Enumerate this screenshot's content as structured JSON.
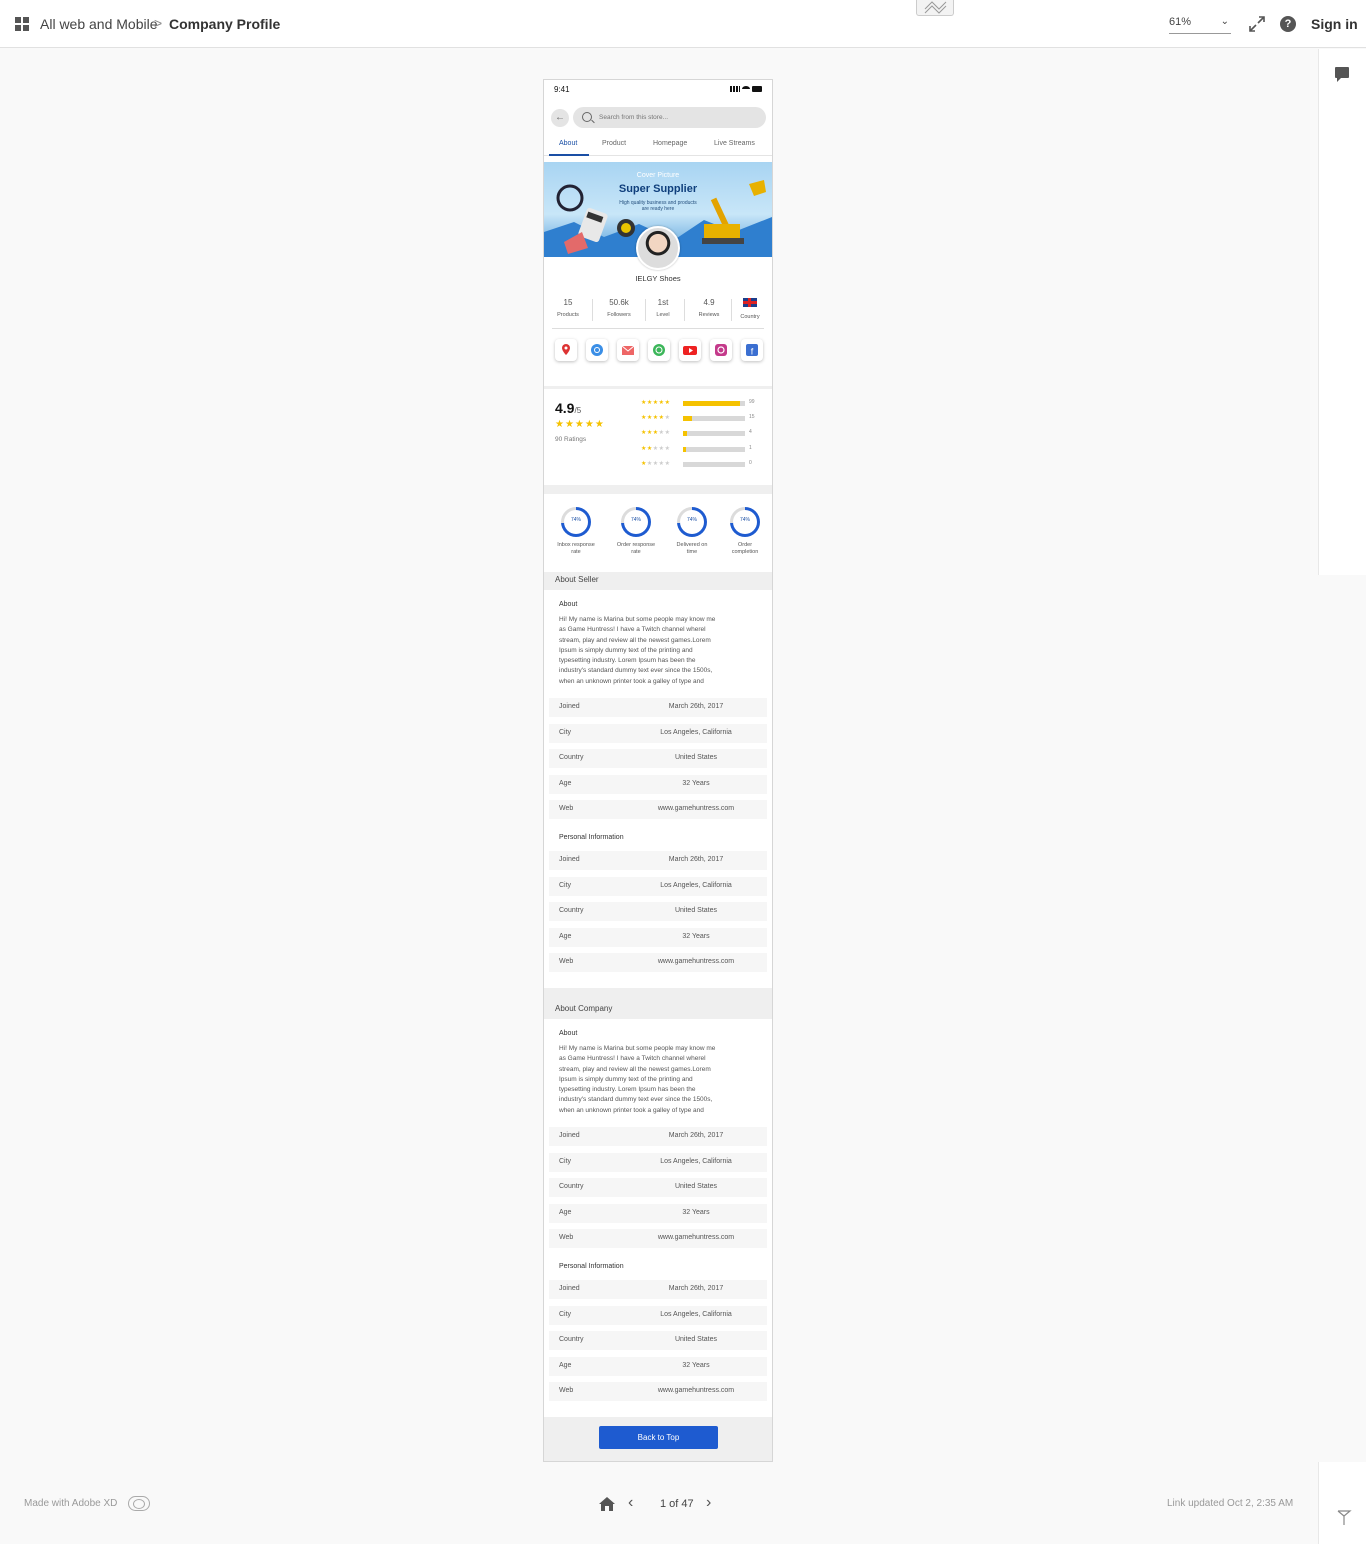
{
  "header": {
    "breadcrumb_root": "All web and Mobile",
    "breadcrumb_sep": ">",
    "breadcrumb_current": "Company Profile",
    "zoom": "61%",
    "help": "?",
    "sign_in": "Sign in"
  },
  "phone": {
    "time": "9:41",
    "search_placeholder": "Search from this store...",
    "tabs": [
      "About",
      "Product",
      "Homepage",
      "Live Streams"
    ],
    "active_tab": "About",
    "cover": {
      "label": "Cover Picture",
      "title": "Super Supplier",
      "subtitle_1": "High quality business and products",
      "subtitle_2": "are ready here"
    },
    "store_name": "IELGY Shoes",
    "stats": [
      {
        "value": "15",
        "label": "Products"
      },
      {
        "value": "50.6k",
        "label": "Followers"
      },
      {
        "value": "1st",
        "label": "Level"
      },
      {
        "value": "4.9",
        "label": "Reviews"
      },
      {
        "value": "",
        "label": "Country"
      }
    ],
    "social_icons": [
      "map-pin-icon",
      "chrome-icon",
      "mail-icon",
      "whatsapp-icon",
      "youtube-icon",
      "instagram-icon",
      "facebook-icon"
    ],
    "rating": {
      "score": "4.9",
      "out_of": "/5",
      "stars": "★★★★★",
      "count_text": "90 Ratings",
      "rows": [
        {
          "stars": 5,
          "count": "99",
          "fill": 0.92
        },
        {
          "stars": 4,
          "count": "15",
          "fill": 0.15
        },
        {
          "stars": 3,
          "count": "4",
          "fill": 0.06
        },
        {
          "stars": 2,
          "count": "1",
          "fill": 0.05
        },
        {
          "stars": 1,
          "count": "0",
          "fill": 0.0
        }
      ]
    },
    "metrics": [
      {
        "value": "74%",
        "label_1": "Inbox response",
        "label_2": "rate",
        "fraction": 0.74
      },
      {
        "value": "74%",
        "label_1": "Order response",
        "label_2": "rate",
        "fraction": 0.74
      },
      {
        "value": "74%",
        "label_1": "Delivered on",
        "label_2": "time",
        "fraction": 0.74
      },
      {
        "value": "74%",
        "label_1": "Order",
        "label_2": "completion",
        "fraction": 0.74
      }
    ],
    "seller": {
      "section_title": "About Seller",
      "about_title": "About",
      "about_lines": [
        "Hi! My name is Marina but some people may know me",
        "as Game Huntress! I have a Twitch channel wherel",
        "stream, play and review all the newest games.Lorem",
        "Ipsum is simply dummy text of the printing and",
        "typesetting industry. Lorem Ipsum has been the",
        "industry's standard dummy text ever since the 1500s,",
        "when an unknown printer took a galley of type and"
      ],
      "rows": [
        {
          "k": "Joined",
          "v": "March 26th, 2017"
        },
        {
          "k": "City",
          "v": "Los Angeles, California"
        },
        {
          "k": "Country",
          "v": "United States"
        },
        {
          "k": "Age",
          "v": "32 Years"
        },
        {
          "k": "Web",
          "v": "www.gamehuntress.com"
        }
      ],
      "personal_title": "Personal Information",
      "personal_rows": [
        {
          "k": "Joined",
          "v": "March 26th, 2017"
        },
        {
          "k": "City",
          "v": "Los Angeles, California"
        },
        {
          "k": "Country",
          "v": "United States"
        },
        {
          "k": "Age",
          "v": "32 Years"
        },
        {
          "k": "Web",
          "v": "www.gamehuntress.com"
        }
      ]
    },
    "company": {
      "section_title": "About Company",
      "about_title": "About",
      "about_lines": [
        "Hi! My name is Marina but some people may know me",
        "as Game Huntress! I have a Twitch channel wherel",
        "stream, play and review all the newest games.Lorem",
        "Ipsum is simply dummy text of the printing and",
        "typesetting industry. Lorem Ipsum has been the",
        "industry's standard dummy text ever since the 1500s,",
        "when an unknown printer took a galley of type and"
      ],
      "rows": [
        {
          "k": "Joined",
          "v": "March 26th, 2017"
        },
        {
          "k": "City",
          "v": "Los Angeles, California"
        },
        {
          "k": "Country",
          "v": "United States"
        },
        {
          "k": "Age",
          "v": "32 Years"
        },
        {
          "k": "Web",
          "v": "www.gamehuntress.com"
        }
      ],
      "personal_title": "Personal Information",
      "personal_rows": [
        {
          "k": "Joined",
          "v": "March 26th, 2017"
        },
        {
          "k": "City",
          "v": "Los Angeles, California"
        },
        {
          "k": "Country",
          "v": "United States"
        },
        {
          "k": "Age",
          "v": "32 Years"
        },
        {
          "k": "Web",
          "v": "www.gamehuntress.com"
        }
      ]
    },
    "back_to_top": "Back to Top"
  },
  "footer": {
    "made_with": "Made with Adobe XD",
    "page_indicator": "1 of 47",
    "link_updated": "Link updated Oct 2, 2:35 AM"
  },
  "colors": {
    "accent": "#1e5bd0",
    "tab_active": "#1a4fa5",
    "star": "#f5c200"
  }
}
